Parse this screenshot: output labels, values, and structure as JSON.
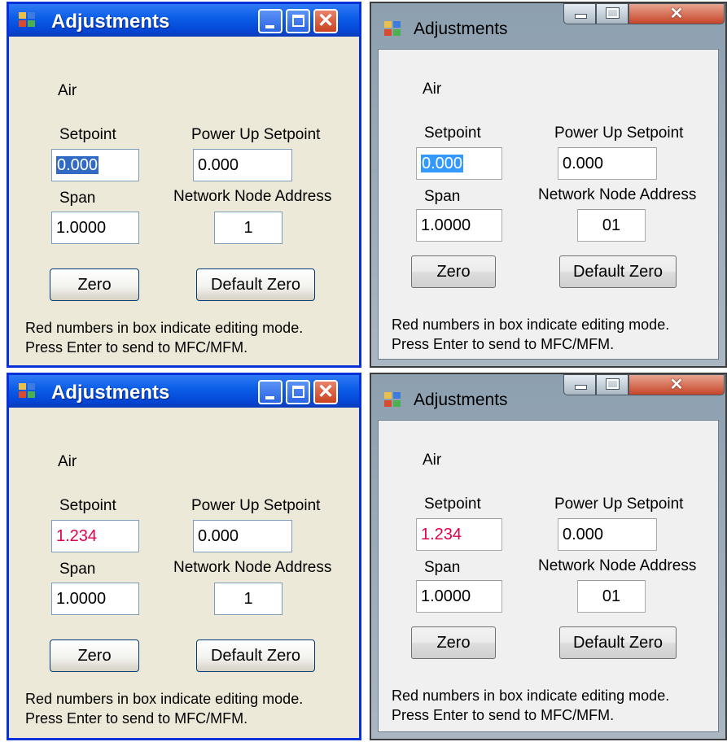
{
  "windows": [
    {
      "style": "xp",
      "title": "Adjustments",
      "gas": "Air",
      "setpoint_label": "Setpoint",
      "setpoint_value": "0.000",
      "setpoint_state": "selected",
      "power_up_setpoint_label": "Power Up Setpoint",
      "power_up_setpoint_value": "0.000",
      "span_label": "Span",
      "span_value": "1.0000",
      "network_node_address_label": "Network Node Address",
      "network_node_address_value": "1",
      "zero_button": "Zero",
      "default_zero_button": "Default Zero",
      "info_line1": "Red numbers in box indicate editing mode.",
      "info_line2": "Press Enter to send to MFC/MFM."
    },
    {
      "style": "vista",
      "title": "Adjustments",
      "gas": "Air",
      "setpoint_label": "Setpoint",
      "setpoint_value": "0.000",
      "setpoint_state": "selected",
      "power_up_setpoint_label": "Power Up Setpoint",
      "power_up_setpoint_value": "0.000",
      "span_label": "Span",
      "span_value": "1.0000",
      "network_node_address_label": "Network Node Address",
      "network_node_address_value": "01",
      "zero_button": "Zero",
      "default_zero_button": "Default Zero",
      "info_line1": "Red numbers in box indicate editing mode.",
      "info_line2": "Press Enter to send to MFC/MFM."
    },
    {
      "style": "xp",
      "title": "Adjustments",
      "gas": "Air",
      "setpoint_label": "Setpoint",
      "setpoint_value": "1.234",
      "setpoint_state": "editing",
      "power_up_setpoint_label": "Power Up Setpoint",
      "power_up_setpoint_value": "0.000",
      "span_label": "Span",
      "span_value": "1.0000",
      "network_node_address_label": "Network Node Address",
      "network_node_address_value": "1",
      "zero_button": "Zero",
      "default_zero_button": "Default Zero",
      "info_line1": "Red numbers in box indicate editing mode.",
      "info_line2": "Press Enter to send to MFC/MFM."
    },
    {
      "style": "vista",
      "title": "Adjustments",
      "gas": "Air",
      "setpoint_label": "Setpoint",
      "setpoint_value": "1.234",
      "setpoint_state": "editing",
      "power_up_setpoint_label": "Power Up Setpoint",
      "power_up_setpoint_value": "0.000",
      "span_label": "Span",
      "span_value": "1.0000",
      "network_node_address_label": "Network Node Address",
      "network_node_address_value": "01",
      "zero_button": "Zero",
      "default_zero_button": "Default Zero",
      "info_line1": "Red numbers in box indicate editing mode.",
      "info_line2": "Press Enter to send to MFC/MFM."
    }
  ],
  "titlebar": {
    "min_glyph": "minimize-icon",
    "max_glyph": "maximize-icon",
    "close_glyph": "close-icon",
    "close_char": "✕"
  },
  "colors": {
    "editing_text": "#e0004e",
    "xp_selection": "#316ac5",
    "vista_selection": "#3399ff",
    "xp_titlebar": "#0a5ce6"
  }
}
